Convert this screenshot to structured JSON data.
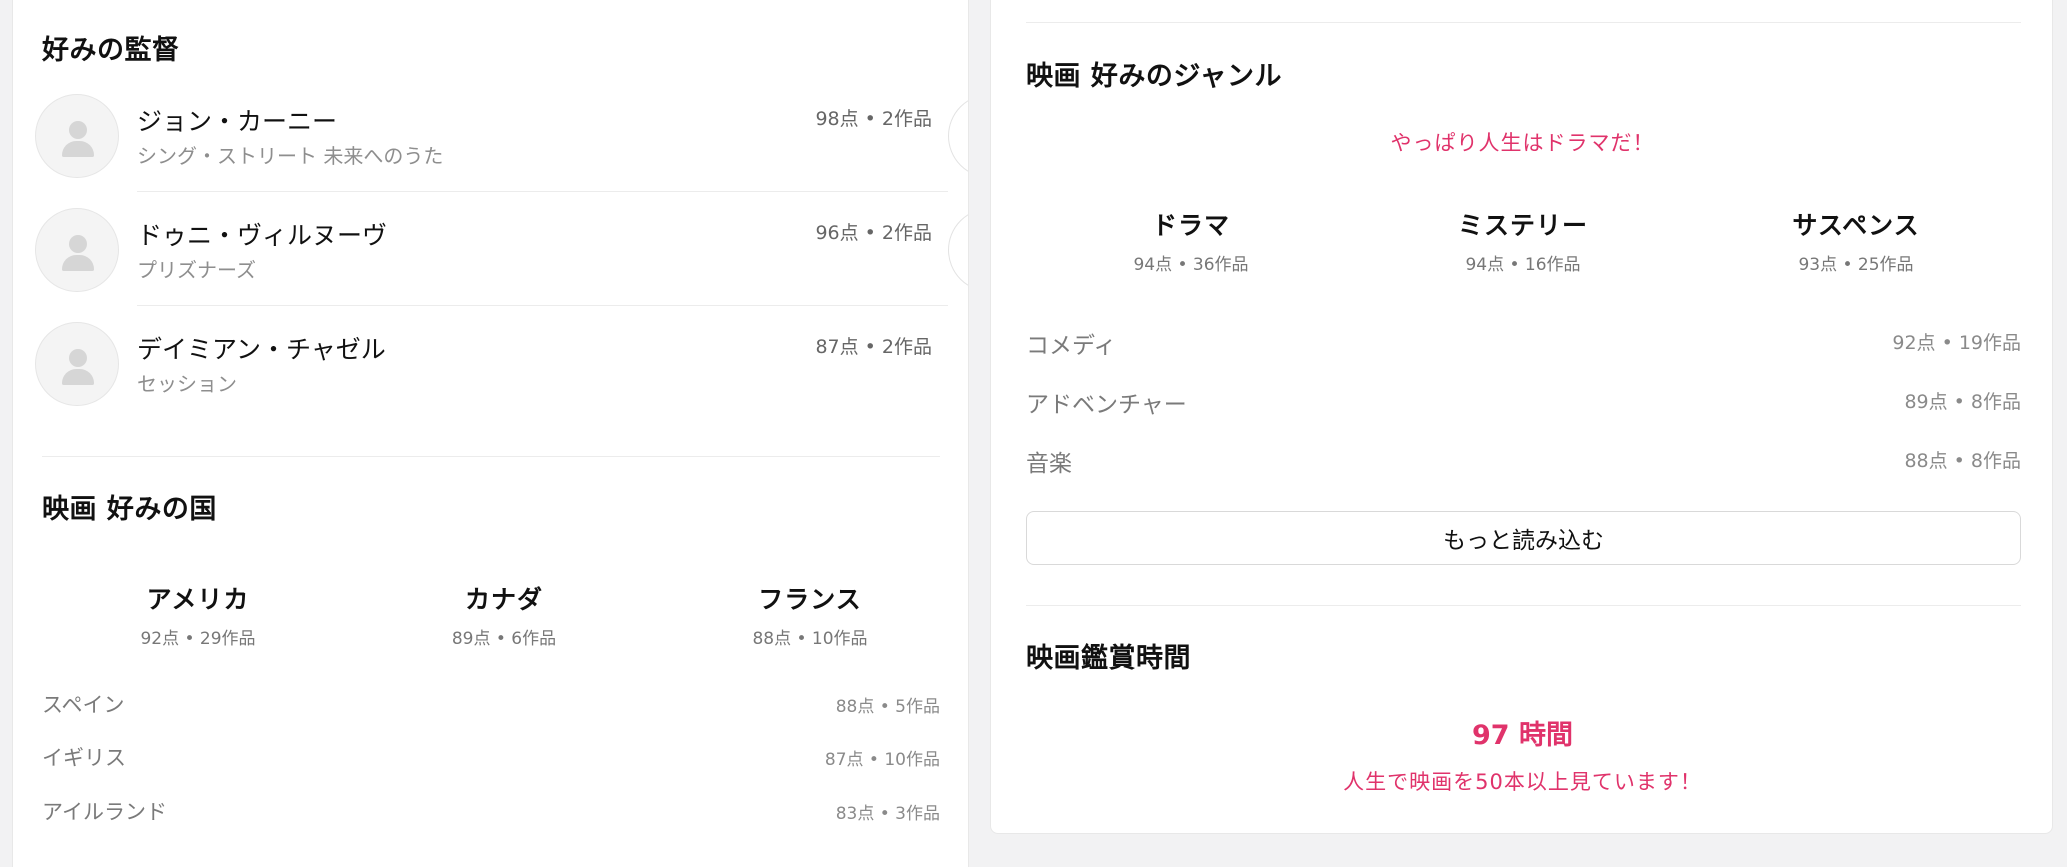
{
  "directors": {
    "title": "好みの監督",
    "items": [
      {
        "name": "ジョン・カーニー",
        "work": "シング・ストリート 未来へのうた",
        "meta": "98点 • 2作品"
      },
      {
        "name": "ドゥニ・ヴィルヌーヴ",
        "work": "プリズナーズ",
        "meta": "96点 • 2作品"
      },
      {
        "name": "デイミアン・チャゼル",
        "work": "セッション",
        "meta": "87点 • 2作品"
      }
    ]
  },
  "countries": {
    "title": "映画 好みの国",
    "top": [
      {
        "name": "アメリカ",
        "meta": "92点 • 29作品"
      },
      {
        "name": "カナダ",
        "meta": "89点 • 6作品"
      },
      {
        "name": "フランス",
        "meta": "88点 • 10作品"
      }
    ],
    "list": [
      {
        "name": "スペイン",
        "meta": "88点 • 5作品"
      },
      {
        "name": "イギリス",
        "meta": "87点 • 10作品"
      },
      {
        "name": "アイルランド",
        "meta": "83点 • 3作品"
      }
    ]
  },
  "genres": {
    "title": "映画 好みのジャンル",
    "tagline": "やっぱり人生はドラマだ！",
    "top": [
      {
        "name": "ドラマ",
        "meta": "94点 • 36作品"
      },
      {
        "name": "ミステリー",
        "meta": "94点 • 16作品"
      },
      {
        "name": "サスペンス",
        "meta": "93点 • 25作品"
      }
    ],
    "list": [
      {
        "name": "コメディ",
        "meta": "92点 • 19作品"
      },
      {
        "name": "アドベンチャー",
        "meta": "89点 • 8作品"
      },
      {
        "name": "音楽",
        "meta": "88点 • 8作品"
      }
    ],
    "more_label": "もっと読み込む"
  },
  "watch_time": {
    "title": "映画鑑賞時間",
    "value": "97 時間",
    "subtitle": "人生で映画を50本以上見ています！"
  },
  "colors": {
    "accent": "#e0336b"
  }
}
